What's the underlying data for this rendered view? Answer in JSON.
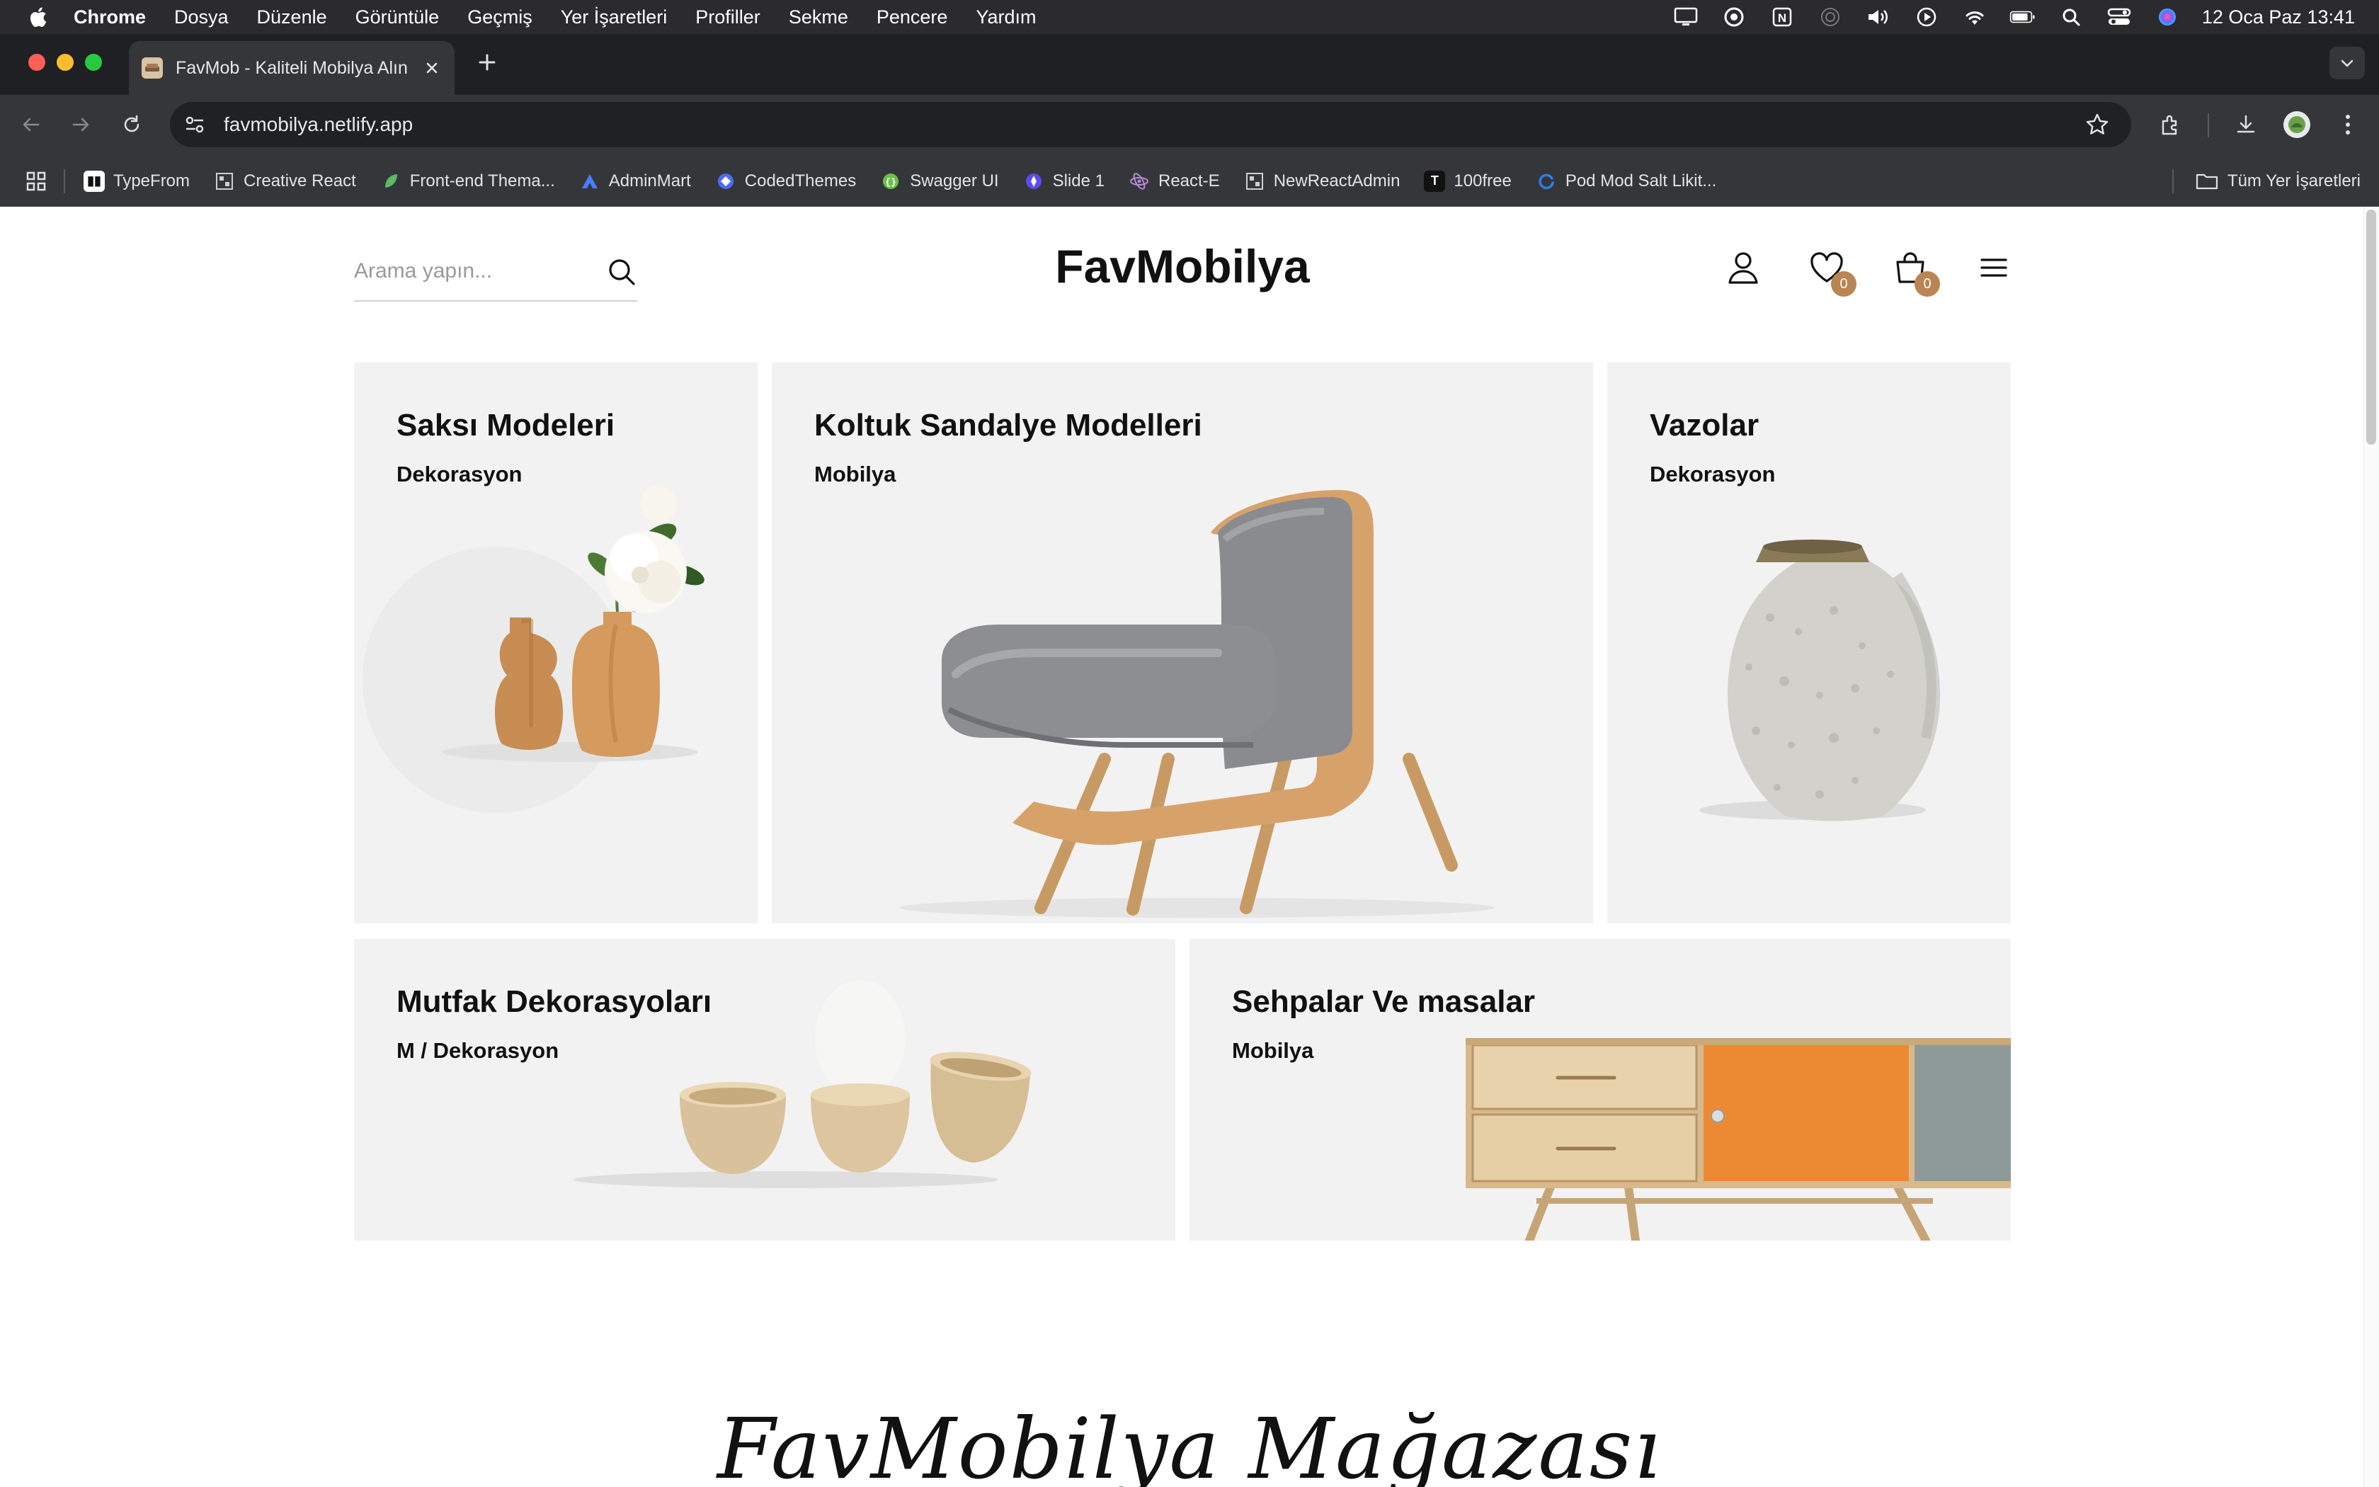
{
  "menubar": {
    "app": "Chrome",
    "items": [
      "Dosya",
      "Düzenle",
      "Görüntüle",
      "Geçmiş",
      "Yer İşaretleri",
      "Profiller",
      "Sekme",
      "Pencere",
      "Yardım"
    ],
    "clock": "12 Oca Paz  13:41"
  },
  "browser": {
    "tab_title": "FavMob - Kaliteli Mobilya Alın",
    "url": "favmobilya.netlify.app",
    "bookmarks": [
      {
        "label": "TypeFrom",
        "icon": "typeform-icon",
        "color": "#ffffff"
      },
      {
        "label": "Creative React",
        "icon": "grid-icon",
        "color": "#cfcfcf"
      },
      {
        "label": "Front-end Thema...",
        "icon": "leaf-icon",
        "color": "#5dbb63"
      },
      {
        "label": "AdminMart",
        "icon": "adminmart-icon",
        "color": "#4a7dff"
      },
      {
        "label": "CodedThemes",
        "icon": "codedthemes-icon",
        "color": "#4a6cf7"
      },
      {
        "label": "Swagger UI",
        "icon": "swagger-icon",
        "color": "#6cc04a"
      },
      {
        "label": "Slide 1",
        "icon": "slide-icon",
        "color": "#5b4cf0"
      },
      {
        "label": "React-E",
        "icon": "react-icon",
        "color": "#b58ad6"
      },
      {
        "label": "NewReactAdmin",
        "icon": "grid-icon",
        "color": "#cfcfcf"
      },
      {
        "label": "100free",
        "icon": "t-icon",
        "color": "#111111"
      },
      {
        "label": "Pod Mod Salt Likit...",
        "icon": "refresh-brand-icon",
        "color": "#2f7de1"
      }
    ],
    "all_bookmarks": "Tüm Yer İşaretleri"
  },
  "site": {
    "search_placeholder": "Arama yapın...",
    "logo": "FavMobilya",
    "wishlist_count": "0",
    "cart_count": "0",
    "badge_color": "#b98552",
    "categories": [
      {
        "title": "Saksı Modeleri",
        "subtitle": "Dekorasyon"
      },
      {
        "title": "Koltuk Sandalye Modelleri",
        "subtitle": "Mobilya"
      },
      {
        "title": "Vazolar",
        "subtitle": "Dekorasyon"
      },
      {
        "title": "Mutfak Dekorasyoları",
        "subtitle": "M / Dekorasyon"
      },
      {
        "title": "Sehpalar Ve masalar",
        "subtitle": "Mobilya"
      }
    ],
    "section_title": "FavMobilya Mağazası"
  }
}
